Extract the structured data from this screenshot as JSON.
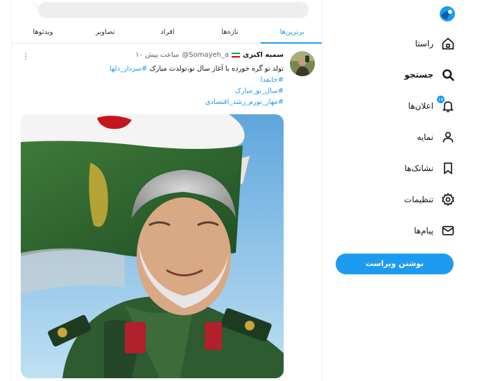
{
  "search": {
    "placeholder": ""
  },
  "tabs": [
    {
      "label": "برترین‌ها",
      "active": true
    },
    {
      "label": "تازه‌ها",
      "active": false
    },
    {
      "label": "افراد",
      "active": false
    },
    {
      "label": "تصاویر",
      "active": false
    },
    {
      "label": "ویدئوها",
      "active": false
    }
  ],
  "tweet": {
    "author_name": "سمیه اکبری",
    "handle": "@Somayeh_a",
    "time": "۱۰ ساعت پیش",
    "text": "تولد تو گره خورده با آغاز سال نو،تولدت  مبارک",
    "inline_hashtag": "#سردار_دلها",
    "hashtags": [
      "#جانفدا",
      "#سال_نو_مبارک",
      "#مهار_تورم_رشد_اقتصادی"
    ],
    "more_icon": "more-vertical-icon",
    "flag_icon": "iran-flag-icon"
  },
  "nav": {
    "items": [
      {
        "label": "راستا",
        "icon": "home-icon",
        "active": false
      },
      {
        "label": "جستجو",
        "icon": "search-icon",
        "active": true
      },
      {
        "label": "اعلان‌ها",
        "icon": "bell-icon",
        "active": false,
        "badge": "۱۷"
      },
      {
        "label": "نمایه",
        "icon": "user-icon",
        "active": false
      },
      {
        "label": "نشانک‌ها",
        "icon": "bookmark-icon",
        "active": false
      },
      {
        "label": "تنظیمات",
        "icon": "gear-icon",
        "active": false
      },
      {
        "label": "پیام‌ها",
        "icon": "mail-icon",
        "active": false
      }
    ],
    "compose_label": "نوشتن ویراست"
  },
  "colors": {
    "accent": "#1d9bf0",
    "text": "#0f1419",
    "muted": "#536471"
  }
}
